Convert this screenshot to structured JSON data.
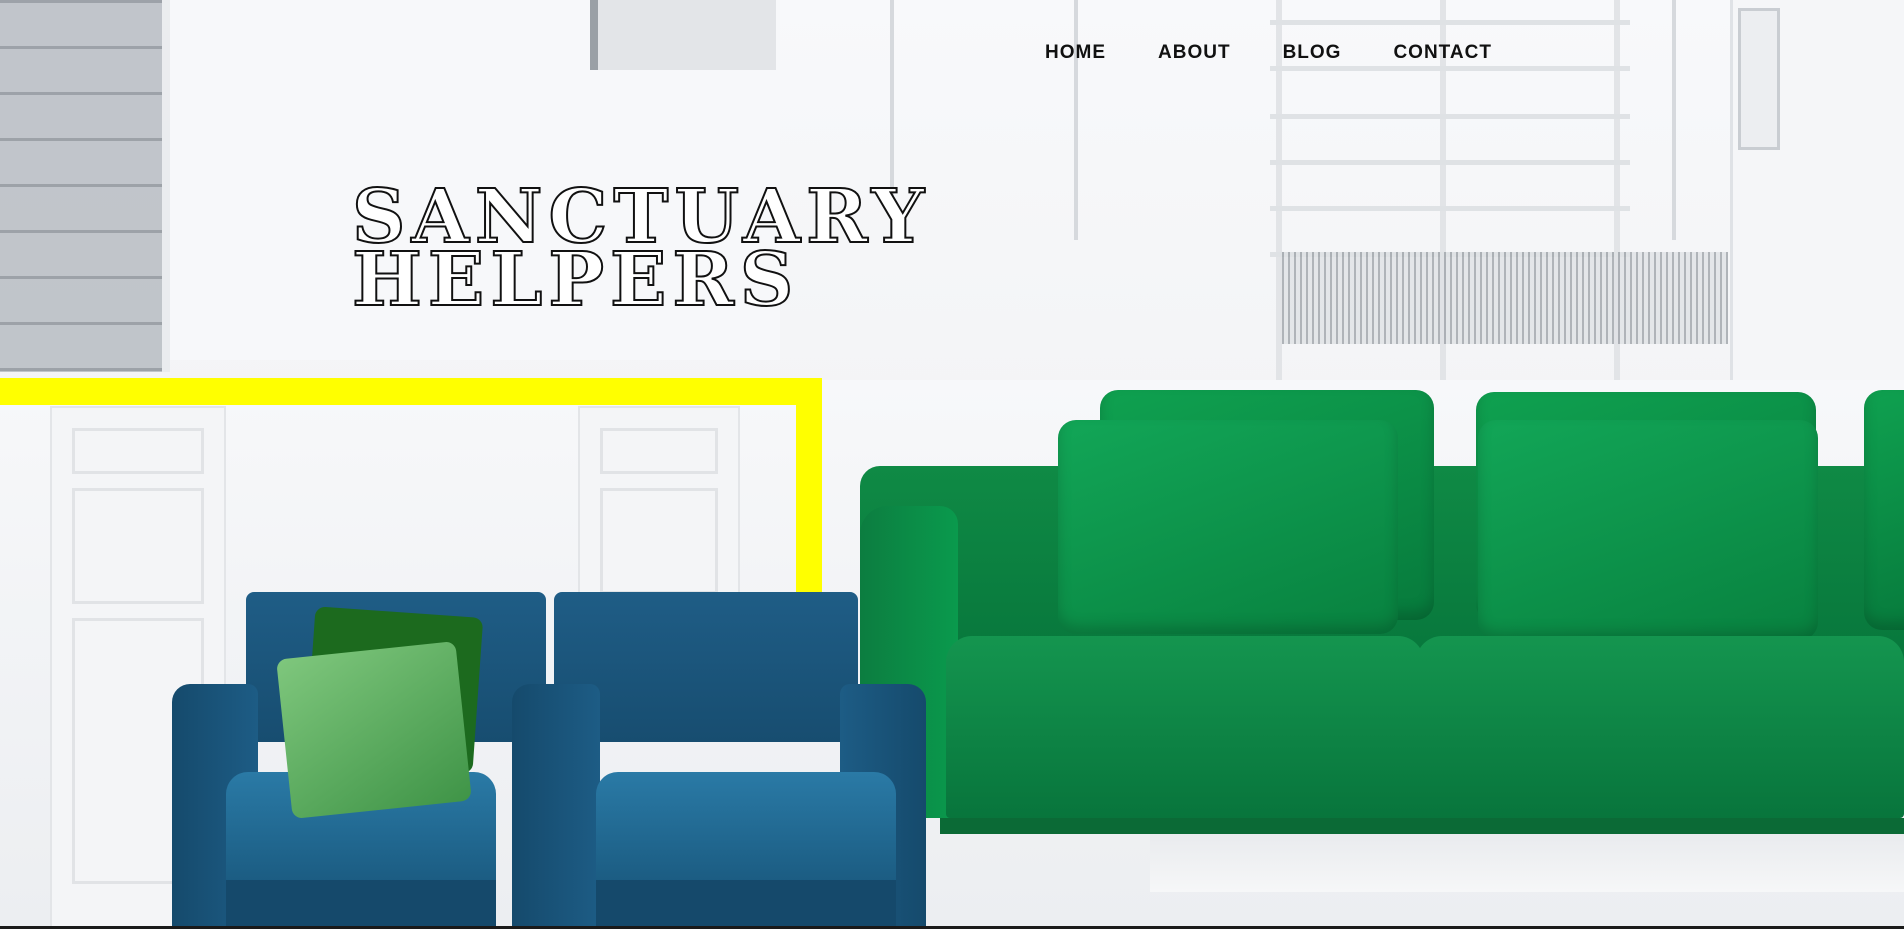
{
  "site": {
    "title_line1": "SANCTUARY",
    "title_line2": "HELPERS"
  },
  "nav": {
    "items": [
      {
        "label": "HOME"
      },
      {
        "label": "ABOUT"
      },
      {
        "label": "BLOG"
      },
      {
        "label": "CONTACT"
      }
    ]
  },
  "colors": {
    "accent_yellow": "#ffff00",
    "sofa_green": "#0a8a45",
    "chair_blue": "#1f5d86",
    "text_dark": "#111111"
  }
}
